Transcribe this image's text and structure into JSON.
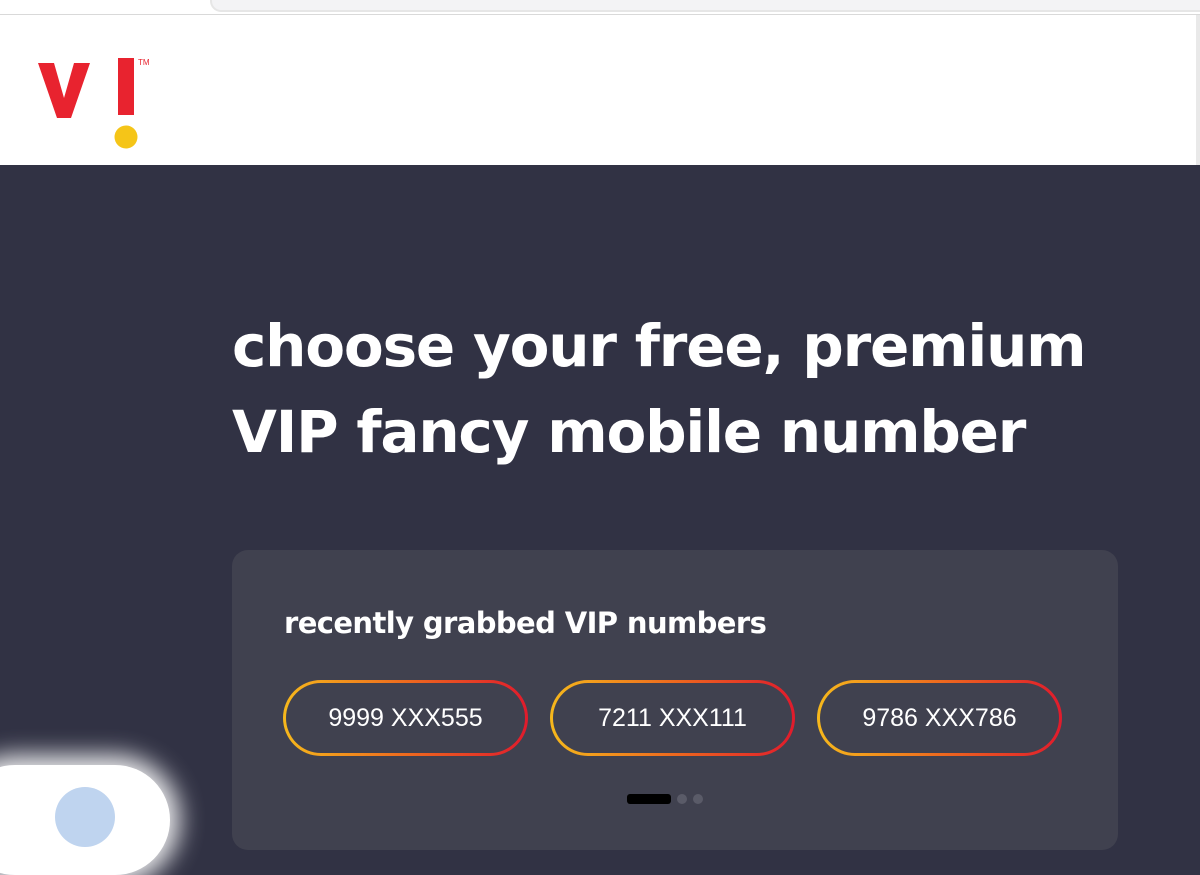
{
  "brand": {
    "logo_text": "VI",
    "trademark": "TM",
    "colors": {
      "red": "#e8232f",
      "yellow": "#f5c518",
      "background": "#313244",
      "card": "#40414f"
    }
  },
  "hero": {
    "headline_line1": "choose your free, premium",
    "headline_line2": "VIP fancy mobile number"
  },
  "vip_card": {
    "title": "recently grabbed VIP numbers",
    "numbers": [
      "9999 XXX555",
      "7211 XXX111",
      "9786 XXX786"
    ],
    "carousel": {
      "total_pages": 3,
      "active_page": 1
    }
  },
  "chat_widget": {
    "icon": "chat-avatar-icon"
  }
}
